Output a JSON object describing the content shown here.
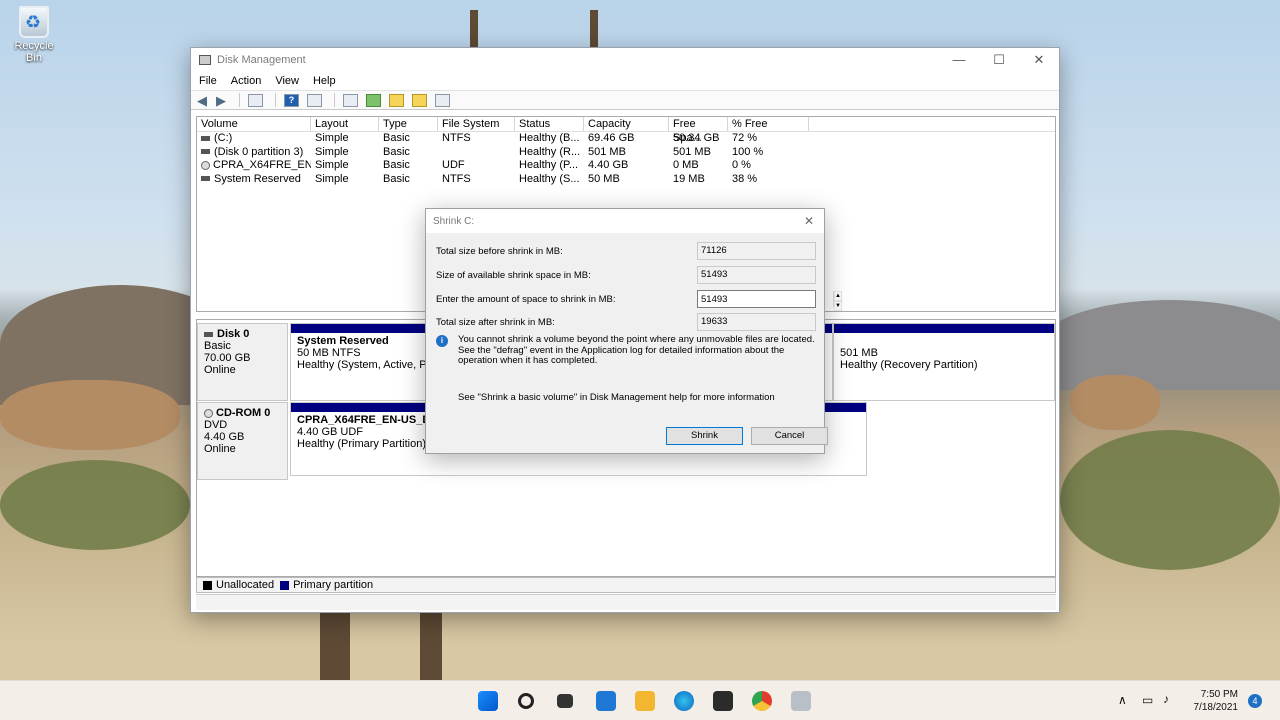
{
  "desktop": {
    "recycle_bin_label": "Recycle Bin"
  },
  "window": {
    "title": "Disk Management",
    "controls": {
      "minimize": "—",
      "maximize": "☐",
      "close": "✕"
    },
    "menu": [
      "File",
      "Action",
      "View",
      "Help"
    ]
  },
  "volumes": {
    "headers": [
      "Volume",
      "Layout",
      "Type",
      "File System",
      "Status",
      "Capacity",
      "Free Spa...",
      "% Free"
    ],
    "rows": [
      {
        "volume": "(C:)",
        "layout": "Simple",
        "type": "Basic",
        "fs": "NTFS",
        "status": "Healthy (B...",
        "capacity": "69.46 GB",
        "free": "50.34 GB",
        "pct": "72 %"
      },
      {
        "volume": "(Disk 0 partition 3)",
        "layout": "Simple",
        "type": "Basic",
        "fs": "",
        "status": "Healthy (R...",
        "capacity": "501 MB",
        "free": "501 MB",
        "pct": "100 %"
      },
      {
        "volume": "CPRA_X64FRE_EN-...",
        "layout": "Simple",
        "type": "Basic",
        "fs": "UDF",
        "status": "Healthy (P...",
        "capacity": "4.40 GB",
        "free": "0 MB",
        "pct": "0 %"
      },
      {
        "volume": "System Reserved",
        "layout": "Simple",
        "type": "Basic",
        "fs": "NTFS",
        "status": "Healthy (S...",
        "capacity": "50 MB",
        "free": "19 MB",
        "pct": "38 %"
      }
    ]
  },
  "disks": {
    "disk0": {
      "name": "Disk 0",
      "kind": "Basic",
      "size": "70.00 GB",
      "state": "Online",
      "p1": {
        "name": "System Reserved",
        "size": "50 MB NTFS",
        "status": "Healthy (System, Active, Pr"
      },
      "p3": {
        "size": "501 MB",
        "status": "Healthy (Recovery Partition)"
      }
    },
    "cdrom0": {
      "name": "CD-ROM 0",
      "kind": "DVD",
      "size": "4.40 GB",
      "state": "Online",
      "p1": {
        "name": "CPRA_X64FRE_EN-US_DV5",
        "size": "4.40 GB UDF",
        "status": "Healthy (Primary Partition)"
      }
    }
  },
  "legend": {
    "unallocated": "Unallocated",
    "primary": "Primary partition",
    "unallocated_color": "#000000",
    "primary_color": "#000080"
  },
  "dialog": {
    "title": "Shrink C:",
    "close": "✕",
    "total_before_label": "Total size before shrink in MB:",
    "total_before_value": "71126",
    "available_label": "Size of available shrink space in MB:",
    "available_value": "51493",
    "amount_label": "Enter the amount of space to shrink in MB:",
    "amount_value": "51493",
    "total_after_label": "Total size after shrink in MB:",
    "total_after_value": "19633",
    "info_text_1": "You cannot shrink a volume beyond the point where any unmovable files are located.",
    "info_text_2": "See the \"defrag\" event in the Application log for detailed information about the",
    "info_text_3": "operation when it has completed.",
    "help_text": "See \"Shrink a basic volume\" in Disk Management help for more information",
    "shrink_button": "Shrink",
    "cancel_button": "Cancel"
  },
  "taskbar": {
    "time": "7:50 PM",
    "date": "7/18/2021",
    "notification_count": "4",
    "apps": [
      "start-icon",
      "search-icon",
      "task-view-icon",
      "widgets-icon",
      "file-explorer-icon",
      "edge-icon",
      "store-icon",
      "chrome-icon",
      "disk-management-icon"
    ]
  }
}
